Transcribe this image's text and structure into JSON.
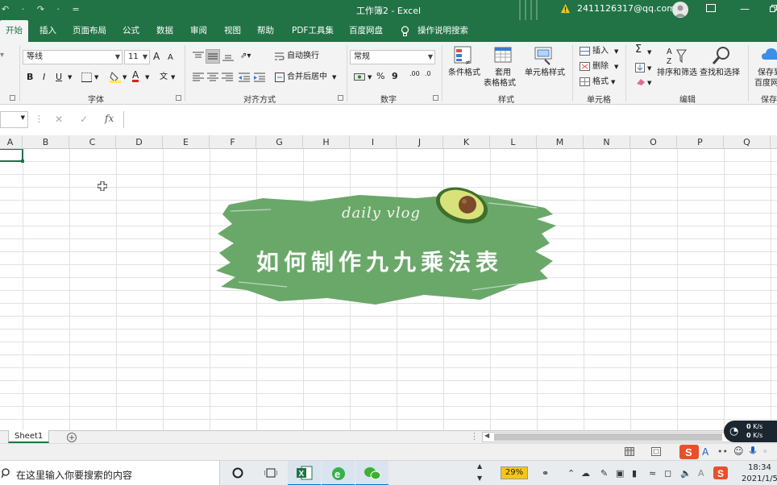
{
  "titlebar": {
    "quick_access": "↶ · ↷ · =",
    "doc_title": "工作簿2  -  Excel",
    "account": "2411126317@qq.com"
  },
  "tabs": [
    "开始",
    "插入",
    "页面布局",
    "公式",
    "数据",
    "审阅",
    "视图",
    "帮助",
    "PDF工具集",
    "百度网盘"
  ],
  "tell_me": "操作说明搜索",
  "ribbon": {
    "font_group": {
      "label": "字体",
      "font_name": "等线",
      "font_size": "11",
      "grow": "A",
      "shrink": "A",
      "bold": "B",
      "italic": "I",
      "underline": "U",
      "font_color_letter": "A",
      "wen": "文"
    },
    "align_group": {
      "label": "对齐方式",
      "wrap": "自动换行",
      "merge": "合并后居中"
    },
    "number_group": {
      "label": "数字",
      "format": "常规",
      "percent": "%",
      "comma": "9",
      "inc_dec": ".00",
      "dec_dec": ".0"
    },
    "styles_group": {
      "label": "样式",
      "conditional": "条件格式",
      "table_fmt_1": "套用",
      "table_fmt_2": "表格格式",
      "cell_styles": "单元格样式"
    },
    "cells_group": {
      "label": "单元格",
      "insert": "插入",
      "delete": "删除",
      "format": "格式"
    },
    "edit_group": {
      "label": "编辑",
      "sigma": "Σ",
      "sort": "排序和筛选",
      "find": "查找和选择"
    },
    "save_group": {
      "label": "保存",
      "line1": "保存到",
      "line2": "百度网"
    }
  },
  "formula_bar": {
    "cancel": "✕",
    "enter": "✓",
    "fx": "fx"
  },
  "columns": [
    "A",
    "B",
    "C",
    "D",
    "E",
    "F",
    "G",
    "H",
    "I",
    "J",
    "K",
    "L",
    "M",
    "N",
    "O",
    "P",
    "Q"
  ],
  "banner": {
    "subtitle": "daily vlog",
    "title": "如何制作九九乘法表"
  },
  "sheets": [
    "Sheet1"
  ],
  "net_widget": {
    "speed_up": "0",
    "speed_down": "0",
    "unit": "K/s"
  },
  "taskbar": {
    "search_placeholder": "在这里输入你要搜索的内容",
    "battery_percent": "29%",
    "time": "18:34",
    "date": "2021/1/5"
  },
  "colors": {
    "excel_green": "#217346",
    "banner_green": "#6aa86a",
    "avocado_skin": "#3e6f2b",
    "avocado_flesh": "#d9e27a",
    "avocado_pit": "#7a4a2a"
  }
}
